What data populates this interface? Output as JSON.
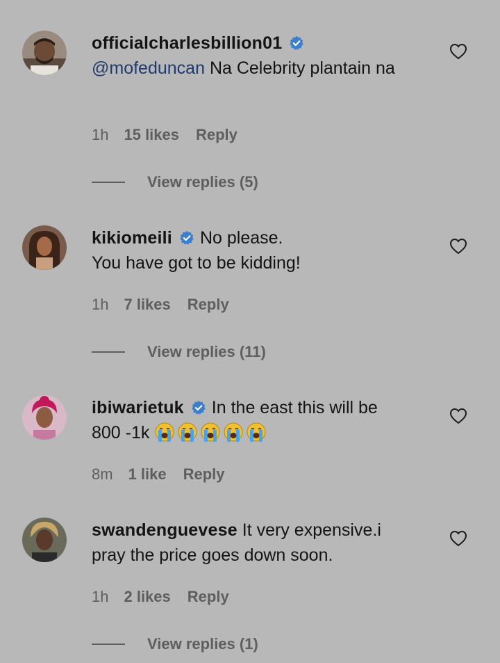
{
  "comments": [
    {
      "username": "officialcharlesbillion01",
      "verified": true,
      "mention": "@mofeduncan",
      "text": "Na Celebrity plantain na",
      "time": "1h",
      "likes": "15 likes",
      "reply": "Reply",
      "view_replies": "View replies (5)",
      "liked": false
    },
    {
      "username": "kikiomeili",
      "verified": true,
      "text_line1": "No please.",
      "text_line2": "You have got to be kidding!",
      "time": "1h",
      "likes": "7 likes",
      "reply": "Reply",
      "view_replies": "View replies (11)",
      "liked": false
    },
    {
      "username": "ibiwarietuk",
      "verified": true,
      "text_line1": "In the east this will be",
      "text_line2": "800 -1k",
      "emoji": "loudly-crying-face",
      "emoji_count": 5,
      "time": "8m",
      "likes": "1 like",
      "reply": "Reply",
      "liked": false
    },
    {
      "username": "swandenguevese",
      "verified": false,
      "text": "It very expensive.i pray the price goes down soon.",
      "time": "1h",
      "likes": "2 likes",
      "reply": "Reply",
      "view_replies": "View replies (1)",
      "liked": false
    }
  ],
  "icons": {
    "verified": "verified-badge-icon",
    "like": "heart-outline-icon"
  },
  "colors": {
    "background": "#b8b8b8",
    "verified": "#3b7ec9",
    "mention": "#1e3a6e",
    "meta": "#5e5e5e"
  }
}
